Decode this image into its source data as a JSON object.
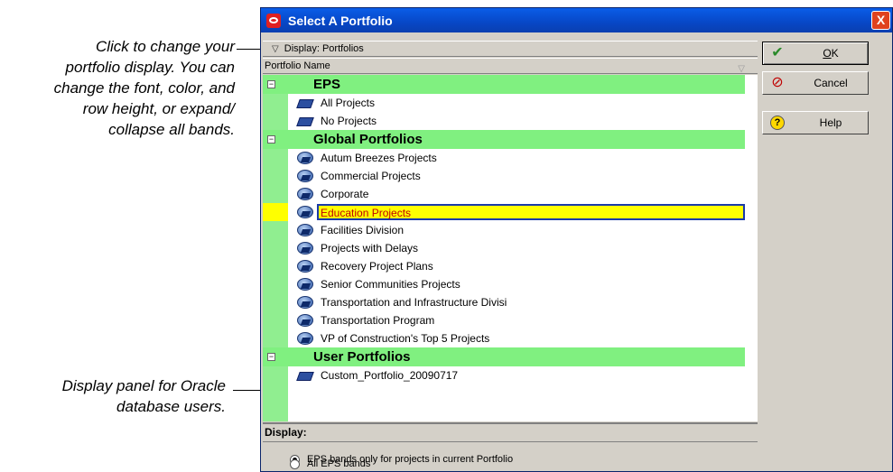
{
  "callouts": {
    "display_note": [
      "Click to change your",
      "portfolio display. You can",
      "change the font, color, and",
      "row height, or expand/",
      "collapse all bands."
    ],
    "panel_note": [
      "Display panel for Oracle",
      "database users."
    ]
  },
  "dialog": {
    "title": "Select A Portfolio",
    "close_label": "X"
  },
  "display_bar": {
    "chevron": "▽",
    "label": "Display: Portfolios"
  },
  "column_header": {
    "label": "Portfolio Name",
    "sort_glyph": "▽"
  },
  "bands": [
    {
      "title": "EPS",
      "toggle": "−",
      "items": [
        "All Projects",
        "No Projects"
      ],
      "icon": "eps-node-icon"
    },
    {
      "title": "Global Portfolios",
      "toggle": "−",
      "items": [
        "Autum Breezes Projects",
        "Commercial Projects",
        "Corporate",
        "Education Projects",
        "Facilities Division",
        "Projects with Delays",
        "Recovery Project Plans",
        "Senior Communities Projects",
        "Transportation and Infrastructure Divisi",
        "Transportation Program",
        "VP of Construction's Top 5 Projects"
      ],
      "icon": "portfolio-globe-icon",
      "selected_index": 3
    },
    {
      "title": "User Portfolios",
      "toggle": "−",
      "items": [
        "Custom_Portfolio_20090717"
      ],
      "icon": "eps-node-icon"
    }
  ],
  "display_panel": {
    "header": "Display:",
    "options": [
      {
        "label": "EPS bands only for projects in current Portfolio",
        "checked": true
      },
      {
        "label": "All EPS bands",
        "checked": false
      }
    ]
  },
  "buttons": {
    "ok": {
      "label_prefix": "",
      "underlined": "O",
      "label_suffix": "K",
      "icon": "checkmark-icon"
    },
    "cancel": {
      "label": "Cancel",
      "icon": "no-entry-icon"
    },
    "help": {
      "label": "Help",
      "icon": "help-icon"
    }
  },
  "colors": {
    "band_green": "#80f080",
    "selection_yellow": "#ffff00",
    "selection_text": "#c00000",
    "titlebar_blue": "#0747c6"
  }
}
